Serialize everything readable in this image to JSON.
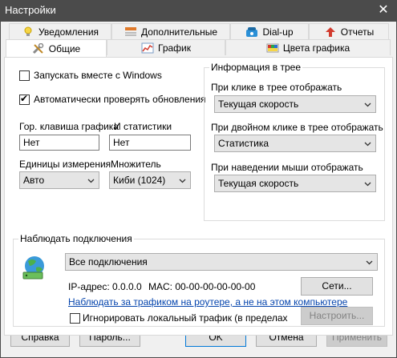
{
  "window": {
    "title": "Настройки",
    "close_glyph": "✕"
  },
  "tabs": {
    "row1": [
      {
        "label": "Уведомления",
        "icon": "lightbulb-icon"
      },
      {
        "label": "Дополнительные",
        "icon": "options-icon"
      },
      {
        "label": "Dial-up",
        "icon": "phone-icon"
      },
      {
        "label": "Отчеты",
        "icon": "upload-arrow-icon"
      }
    ],
    "row2": [
      {
        "label": "Общие",
        "icon": "tools-icon",
        "active": true
      },
      {
        "label": "График",
        "icon": "graph-icon"
      },
      {
        "label": "Цвета графика",
        "icon": "palette-icon"
      }
    ]
  },
  "general": {
    "autostart_label": "Запускать вместе с Windows",
    "autostart_checked": false,
    "autoupdate_label": "Автоматически проверять обновления",
    "autoupdate_checked": true,
    "hotkey_graph_label": "Гор. клавиша графика",
    "hotkey_stats_label": "И статистики",
    "hotkey_graph_value": "Нет",
    "hotkey_stats_value": "Нет",
    "units_label": "Единицы измерения",
    "units_value": "Авто",
    "multiplier_label": "Множитель",
    "multiplier_value": "Киби (1024)"
  },
  "tray": {
    "title": "Информация в трее",
    "click_label": "При клике в трее отображать",
    "click_value": "Текущая скорость",
    "dblclick_label": "При двойном клике в трее отображать",
    "dblclick_value": "Статистика",
    "hover_label": "При наведении мыши отображать",
    "hover_value": "Текущая скорость"
  },
  "monitor": {
    "title": "Наблюдать подключения",
    "icon": "network-globe-icon",
    "connection_value": "Все подключения",
    "ip_text": "IP-адрес: 0.0.0.0",
    "mac_text": "MAC: 00-00-00-00-00-00",
    "networks_button": "Сети...",
    "router_link": "Наблюдать за трафиком на роутере, а не на этом компьютере",
    "ignore_local_label": "Игнорировать локальный трафик (в пределах сети)",
    "ignore_local_checked": false,
    "configure_button": "Настроить..."
  },
  "footer": {
    "help": "Справка",
    "password": "Пароль...",
    "ok": "OK",
    "cancel": "Отмена",
    "apply": "Применить"
  },
  "colors": {
    "titlebar": "#4b4b4b",
    "link": "#0645ad",
    "focus": "#0078d7"
  }
}
